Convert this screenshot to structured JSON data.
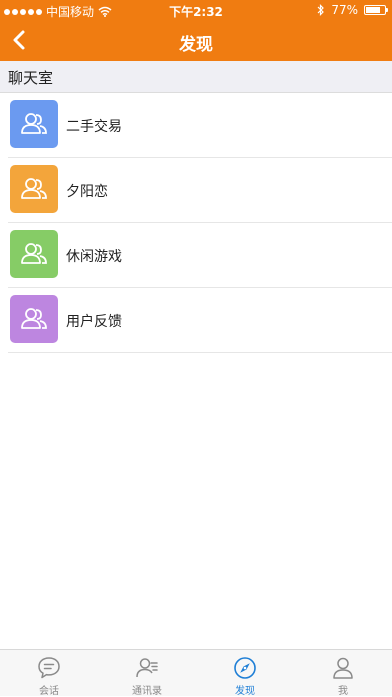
{
  "status_bar": {
    "carrier": "中国移动",
    "time": "下午2:32",
    "battery": "77%",
    "battery_level": 0.77
  },
  "nav": {
    "title": "发现",
    "back_icon": "chevron-left-icon"
  },
  "section": {
    "title": "聊天室"
  },
  "list": {
    "items": [
      {
        "label": "二手交易",
        "color": "#6b9af0",
        "icon": "group-icon"
      },
      {
        "label": "夕阳恋",
        "color": "#f3a53b",
        "icon": "group-icon"
      },
      {
        "label": "休闲游戏",
        "color": "#86cc66",
        "icon": "group-icon"
      },
      {
        "label": "用户反馈",
        "color": "#bd86e0",
        "icon": "group-icon"
      }
    ]
  },
  "tabs": [
    {
      "label": "会话",
      "icon": "chat-bubble-icon",
      "active": false
    },
    {
      "label": "通讯录",
      "icon": "contacts-icon",
      "active": false
    },
    {
      "label": "发现",
      "icon": "compass-icon",
      "active": true
    },
    {
      "label": "我",
      "icon": "person-icon",
      "active": false
    }
  ],
  "colors": {
    "brand": "#f07c11",
    "tab_active": "#1f7fd6",
    "tab_inactive": "#8a8a8a"
  }
}
